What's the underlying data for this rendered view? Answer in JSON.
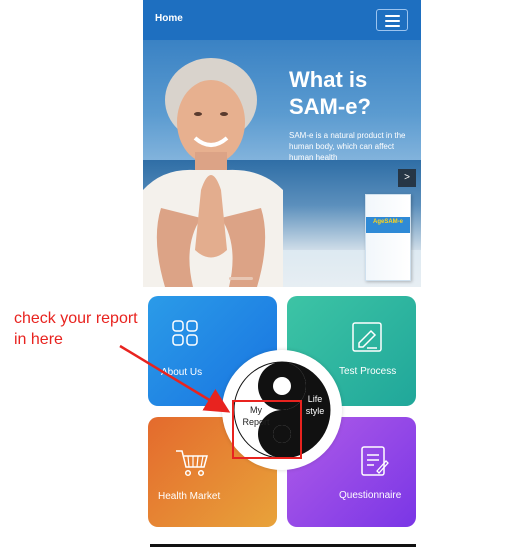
{
  "navbar": {
    "title": "Home",
    "menu_icon": "hamburger-menu-icon",
    "color": "#1e6fc0"
  },
  "hero": {
    "title": "What is\nSAM-e?",
    "description": "SAM-e is a natural product in the human body, which can affect human health",
    "next_icon": "chevron-right-icon",
    "product_name": "AgeSAM-e"
  },
  "tiles": {
    "about": {
      "label": "About Us",
      "icon": "grid-icon",
      "color": "#1f87e6"
    },
    "test": {
      "label": "Test Process",
      "icon": "edit-document-icon",
      "color": "#2fb59f"
    },
    "market": {
      "label": "Health Market",
      "icon": "shopping-cart-icon",
      "color": "#e6803a"
    },
    "questionnaire": {
      "label": "Questionnaire",
      "icon": "clipboard-icon",
      "color": "#944be7"
    }
  },
  "center": {
    "my_report": "My\nReport",
    "lifestyle": "Life\nstyle",
    "icon": "yin-yang-icon"
  },
  "annotation": {
    "text": "check your report in here",
    "color": "#e8231f"
  }
}
